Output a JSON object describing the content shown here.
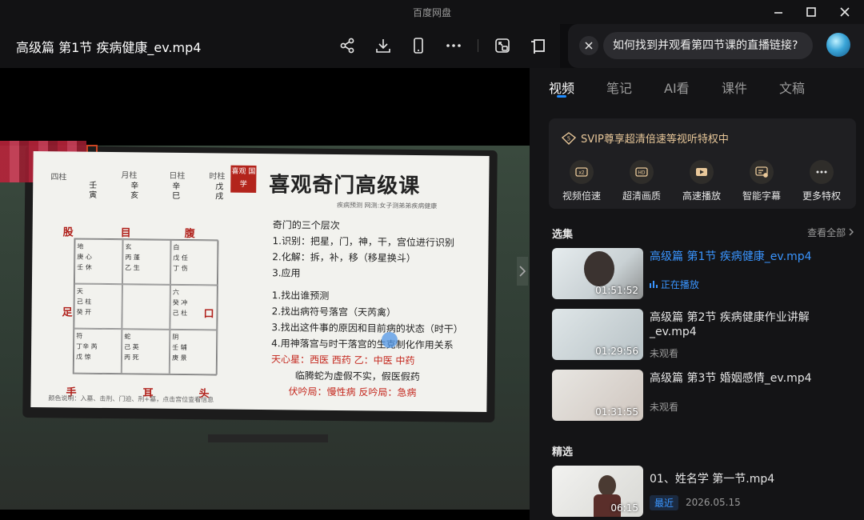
{
  "window": {
    "app_title": "百度网盘"
  },
  "header": {
    "video_title": "高级篇 第1节 疾病健康_ev.mp4"
  },
  "ai": {
    "question": "如何找到并观看第四节课的直播链接?"
  },
  "lesson": {
    "pillar_headers": [
      "月柱",
      "日柱",
      "时柱"
    ],
    "pillar_first": "四柱",
    "stems": [
      "壬",
      "辛",
      "辛",
      "戊"
    ],
    "branches": [
      "寅",
      "亥",
      "巳",
      "戌"
    ],
    "directions": [
      "股",
      "目",
      "腹",
      "足",
      "口",
      "手",
      "耳",
      "头"
    ],
    "cells": [
      [
        "地",
        "庚",
        "心",
        "壬",
        "休"
      ],
      [
        "玄",
        "丙",
        "蓬",
        "乙",
        "生"
      ],
      [
        "白",
        "戊",
        "任",
        "丁",
        "伤"
      ],
      [
        "天",
        "己",
        "柱",
        "癸",
        "开"
      ],
      [
        "",
        "",
        "",
        "",
        ""
      ],
      [
        "六",
        "癸",
        "冲",
        "己",
        "杜"
      ],
      [
        "符",
        "丁辛",
        "芮",
        "戊",
        "惊"
      ],
      [
        "蛇",
        "己",
        "英",
        "丙",
        "死"
      ],
      [
        "阴",
        "壬",
        "辅",
        "庚",
        "景"
      ]
    ],
    "legend": "颜色说明：入墓、击刑、门迫、刑+墓，点击宫位查看信息",
    "stamp": "喜观 国学",
    "title": "喜观奇门高级课",
    "subtitle": "疾病预测 网测:女子测弟弟疾病健康",
    "lines": [
      {
        "text": "奇门的三个层次",
        "red": false
      },
      {
        "text": "1.识别：把星，门，神，干，宫位进行识别",
        "red": false
      },
      {
        "text": "2.化解：拆，补，移（移星换斗）",
        "red": false
      },
      {
        "text": "3.应用",
        "red": false
      },
      {
        "text": "1.找出谁预测",
        "red": false
      },
      {
        "text": "2.找出病符号落宫（天芮禽）",
        "red": false
      },
      {
        "text": "3.找出这件事的原因和目前病的状态（时干）",
        "red": false
      },
      {
        "text": "4.用神落宫与时干落宫的生克制化作用关系",
        "red": false
      },
      {
        "text": "天心星：西医 西药    乙：中医 中药",
        "red": true
      },
      {
        "text": "临腾蛇为虚假不实，假医假药",
        "red": false
      },
      {
        "text": "伏吟局：慢性病    反吟局：急病",
        "red": true
      }
    ]
  },
  "sidebar": {
    "tabs": [
      "视频",
      "笔记",
      "AI看",
      "课件",
      "文稿"
    ],
    "active_tab": 0,
    "svip": {
      "title": "SVIP尊享超清倍速等视听特权中",
      "perks": [
        {
          "label": "视频倍速",
          "icon": "speed-icon"
        },
        {
          "label": "超清画质",
          "icon": "hd-icon"
        },
        {
          "label": "高速播放",
          "icon": "play-fast-icon"
        },
        {
          "label": "智能字幕",
          "icon": "subtitle-icon"
        },
        {
          "label": "更多特权",
          "icon": "more-icon"
        }
      ]
    },
    "episodes_label": "选集",
    "view_all": "查看全部",
    "episodes": [
      {
        "title": "高级篇 第1节 疾病健康_ev.mp4",
        "duration": "01:51:52",
        "status": "正在播放",
        "playing": true
      },
      {
        "title": "高级篇 第2节 疾病健康作业讲解_ev.mp4",
        "duration": "01:29:56",
        "status": "未观看",
        "playing": false
      },
      {
        "title": "高级篇 第3节 婚姻感情_ev.mp4",
        "duration": "01:31:55",
        "status": "未观看",
        "playing": false
      }
    ],
    "featured_label": "精选",
    "featured": {
      "title": "01、姓名学 第一节.mp4",
      "duration": "06:15",
      "badge": "最近",
      "date": "2026.05.15"
    }
  }
}
